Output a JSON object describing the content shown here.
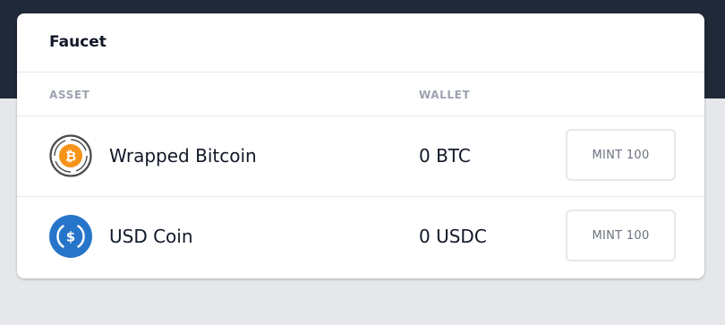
{
  "card": {
    "title": "Faucet"
  },
  "table": {
    "columns": {
      "asset": "ASSET",
      "wallet": "WALLET"
    },
    "rows": [
      {
        "asset_name": "Wrapped Bitcoin",
        "icon": "bitcoin-icon",
        "balance": "0 BTC",
        "mint_label": "MINT 100"
      },
      {
        "asset_name": "USD Coin",
        "icon": "usdc-icon",
        "balance": "0 USDC",
        "mint_label": "MINT 100"
      }
    ]
  },
  "colors": {
    "top_band": "#1f2937",
    "page_background": "#e5e7eb",
    "card_background": "#ffffff",
    "bitcoin_orange": "#f7931a",
    "usdc_blue": "#2775ca",
    "header_muted": "#9ca3af",
    "button_text": "#6b7280",
    "border": "#e5e7eb"
  }
}
